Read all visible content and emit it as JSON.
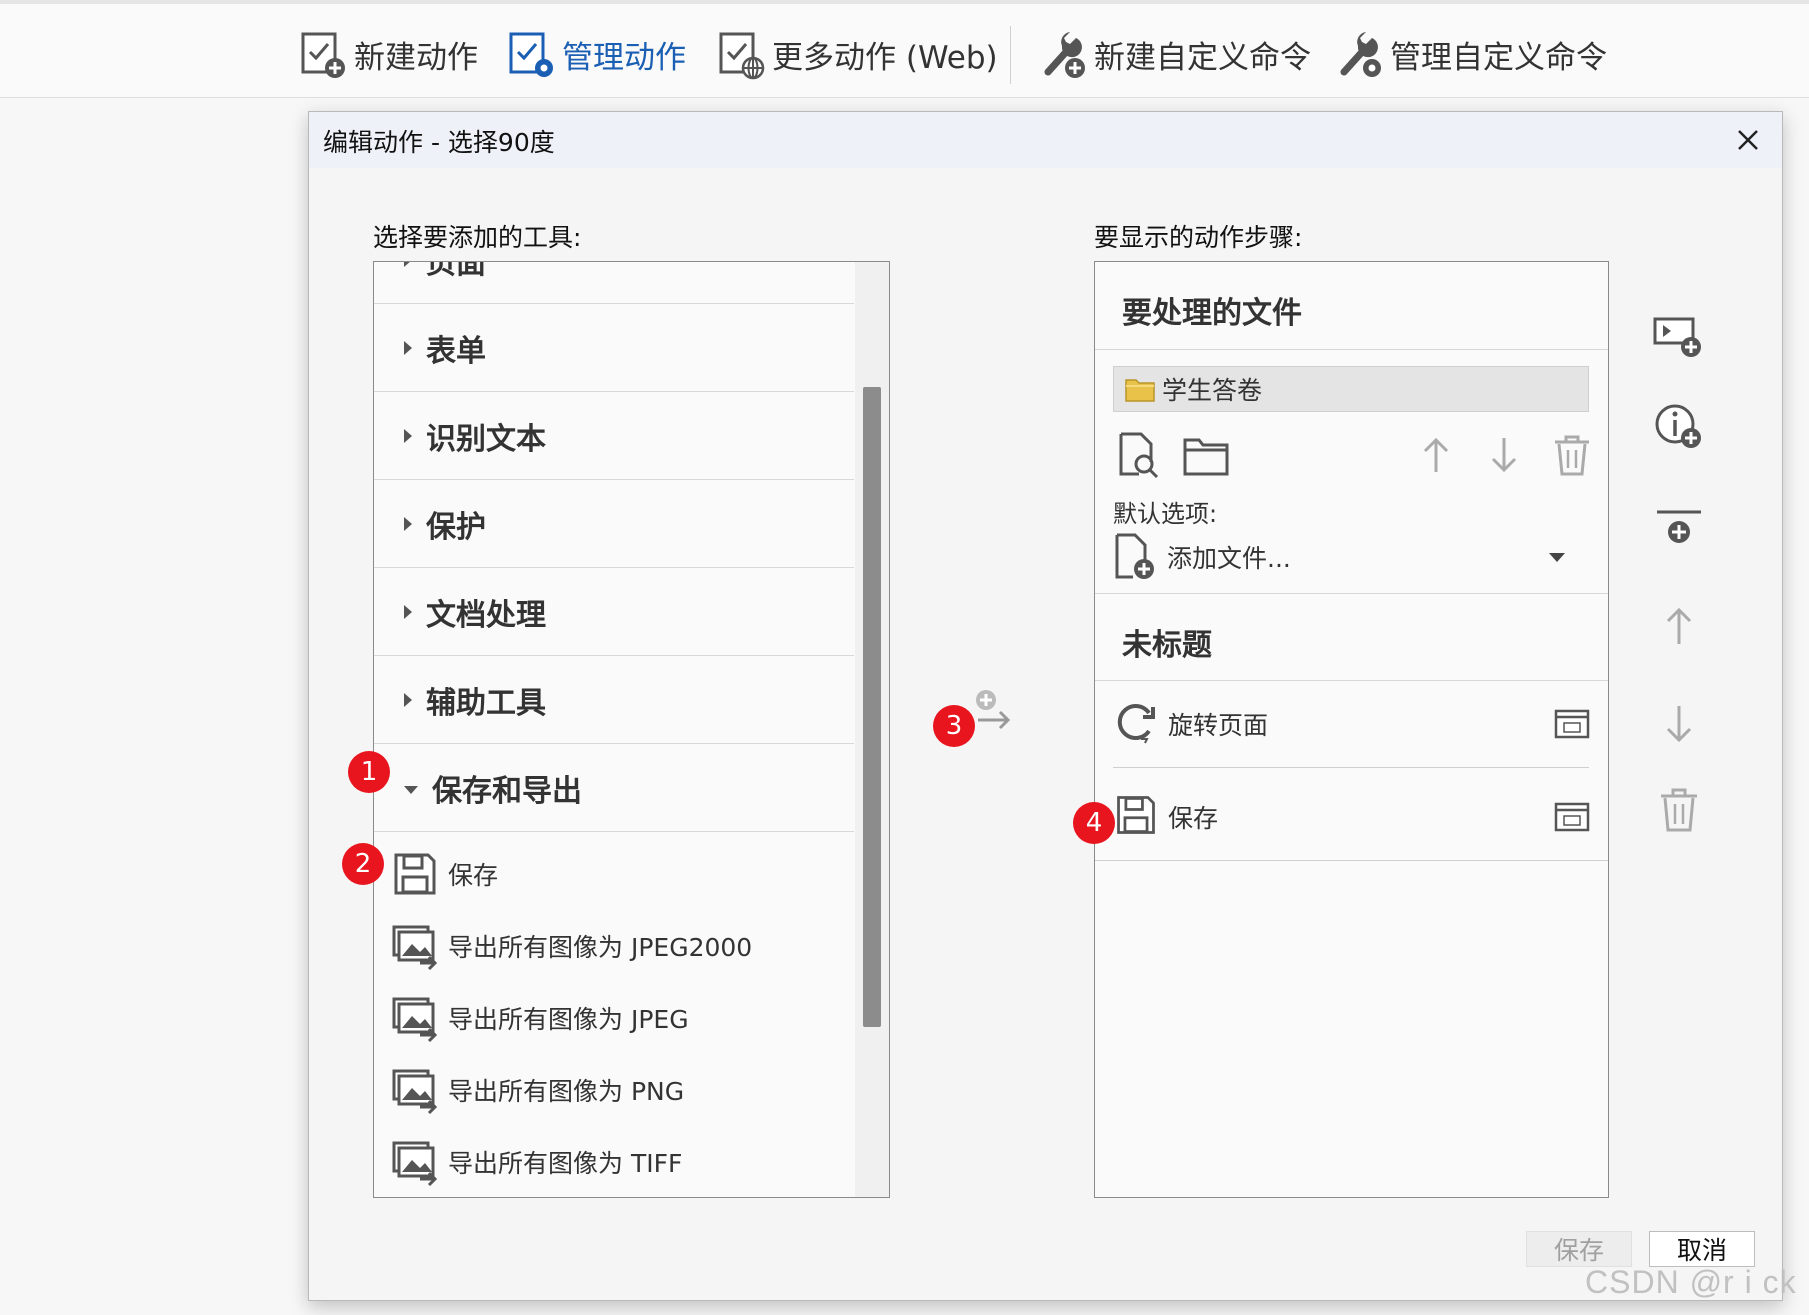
{
  "toolbar": {
    "items": [
      {
        "label": "新建动作",
        "icon": "new-action-icon"
      },
      {
        "label": "管理动作",
        "icon": "manage-actions-icon",
        "active": true
      },
      {
        "label": "更多动作 (Web)",
        "icon": "more-actions-web-icon"
      },
      {
        "label": "新建自定义命令",
        "icon": "new-custom-command-icon"
      },
      {
        "label": "管理自定义命令",
        "icon": "manage-custom-command-icon"
      }
    ]
  },
  "dialog": {
    "title": "编辑动作 - 选择90度",
    "left_label": "选择要添加的工具:",
    "right_label": "要显示的动作步骤:",
    "categories": [
      {
        "label": "页面",
        "expanded": false
      },
      {
        "label": "表单",
        "expanded": false
      },
      {
        "label": "识别文本",
        "expanded": false
      },
      {
        "label": "保护",
        "expanded": false
      },
      {
        "label": "文档处理",
        "expanded": false
      },
      {
        "label": "辅助工具",
        "expanded": false
      },
      {
        "label": "保存和导出",
        "expanded": true
      }
    ],
    "tools": [
      {
        "label": "保存",
        "icon": "save-icon"
      },
      {
        "label": "导出所有图像为 JPEG2000",
        "icon": "export-image-icon"
      },
      {
        "label": "导出所有图像为 JPEG",
        "icon": "export-image-icon"
      },
      {
        "label": "导出所有图像为 PNG",
        "icon": "export-image-icon"
      },
      {
        "label": "导出所有图像为 TIFF",
        "icon": "export-image-icon"
      }
    ],
    "files_section": {
      "title": "要处理的文件",
      "folder": "学生答卷",
      "default_options_label": "默认选项:",
      "add_file_label": "添加文件..."
    },
    "untitled_section": {
      "title": "未标题",
      "steps": [
        {
          "label": "旋转页面",
          "icon": "rotate-page-icon"
        },
        {
          "label": "保存",
          "icon": "save-icon"
        }
      ]
    },
    "buttons": {
      "save": "保存",
      "cancel": "取消"
    }
  },
  "badges": [
    "1",
    "2",
    "3",
    "4"
  ],
  "watermark": "CSDN @r i ck",
  "colors": {
    "accent": "#1a5fb4",
    "badge": "#e8141e",
    "scroll_thumb": "#8c8c8c"
  }
}
